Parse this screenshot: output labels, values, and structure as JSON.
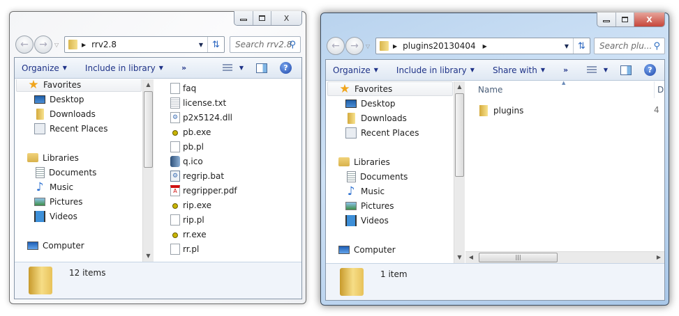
{
  "windows": [
    {
      "path": [
        "rrv2.8"
      ],
      "search_placeholder": "Search rrv2.8",
      "toolbar": [
        "Organize",
        "Include in library"
      ],
      "more": "»",
      "nav": [
        {
          "label": "Favorites",
          "icon": "star",
          "kind": "head",
          "selected": true
        },
        {
          "label": "Desktop",
          "icon": "desktop",
          "kind": "sub"
        },
        {
          "label": "Downloads",
          "icon": "folder",
          "kind": "sub"
        },
        {
          "label": "Recent Places",
          "icon": "recent",
          "kind": "sub"
        },
        {
          "label": "Libraries",
          "icon": "lib",
          "kind": "head",
          "gap": true
        },
        {
          "label": "Documents",
          "icon": "doc",
          "kind": "sub"
        },
        {
          "label": "Music",
          "icon": "music",
          "kind": "sub"
        },
        {
          "label": "Pictures",
          "icon": "pic",
          "kind": "sub"
        },
        {
          "label": "Videos",
          "icon": "vid",
          "kind": "sub"
        },
        {
          "label": "Computer",
          "icon": "comp",
          "kind": "head",
          "gap": true
        }
      ],
      "files": [
        {
          "name": "faq",
          "icon": "blank"
        },
        {
          "name": "license.txt",
          "icon": "txt"
        },
        {
          "name": "p2x5124.dll",
          "icon": "dll"
        },
        {
          "name": "pb.exe",
          "icon": "exe"
        },
        {
          "name": "pb.pl",
          "icon": "blank"
        },
        {
          "name": "q.ico",
          "icon": "ico"
        },
        {
          "name": "regrip.bat",
          "icon": "bat"
        },
        {
          "name": "regripper.pdf",
          "icon": "pdf"
        },
        {
          "name": "rip.exe",
          "icon": "exe"
        },
        {
          "name": "rip.pl",
          "icon": "blank"
        },
        {
          "name": "rr.exe",
          "icon": "exe"
        },
        {
          "name": "rr.pl",
          "icon": "blank"
        }
      ],
      "item_count": "12 items",
      "active": false
    },
    {
      "path": [
        "plugins20130404"
      ],
      "search_placeholder": "Search plu...",
      "toolbar": [
        "Organize",
        "Include in library",
        "Share with"
      ],
      "more": "»",
      "column_name": "Name",
      "column_next": "D",
      "nav": [
        {
          "label": "Favorites",
          "icon": "star",
          "kind": "head",
          "selected": true
        },
        {
          "label": "Desktop",
          "icon": "desktop",
          "kind": "sub"
        },
        {
          "label": "Downloads",
          "icon": "folder",
          "kind": "sub"
        },
        {
          "label": "Recent Places",
          "icon": "recent",
          "kind": "sub"
        },
        {
          "label": "Libraries",
          "icon": "lib",
          "kind": "head",
          "gap": true
        },
        {
          "label": "Documents",
          "icon": "doc",
          "kind": "sub"
        },
        {
          "label": "Music",
          "icon": "music",
          "kind": "sub"
        },
        {
          "label": "Pictures",
          "icon": "pic",
          "kind": "sub"
        },
        {
          "label": "Videos",
          "icon": "vid",
          "kind": "sub"
        },
        {
          "label": "Computer",
          "icon": "comp",
          "kind": "head",
          "gap": true
        }
      ],
      "files": [
        {
          "name": "plugins",
          "icon": "fold",
          "extra": "4"
        }
      ],
      "item_count": "1 item",
      "active": true
    }
  ],
  "caption": {
    "minimize": "—",
    "maximize": "□",
    "close": "X"
  },
  "icons": {
    "back": "arrow-left",
    "forward": "arrow-right",
    "refresh": "refresh",
    "search": "magnifier",
    "help": "question"
  }
}
